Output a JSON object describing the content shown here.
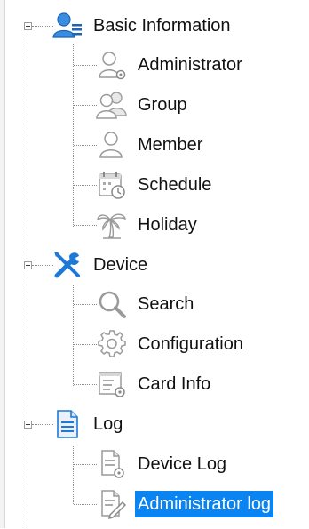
{
  "tree": {
    "groups": [
      {
        "label": "Basic Information",
        "icon": "users-list-icon",
        "children": [
          {
            "label": "Administrator",
            "icon": "admin-user-icon"
          },
          {
            "label": "Group",
            "icon": "group-icon"
          },
          {
            "label": "Member",
            "icon": "member-icon"
          },
          {
            "label": "Schedule",
            "icon": "schedule-icon"
          },
          {
            "label": "Holiday",
            "icon": "palm-tree-icon"
          }
        ]
      },
      {
        "label": "Device",
        "icon": "tools-icon",
        "children": [
          {
            "label": "Search",
            "icon": "magnifier-icon"
          },
          {
            "label": "Configuration",
            "icon": "gear-icon"
          },
          {
            "label": "Card Info",
            "icon": "card-info-icon"
          }
        ]
      },
      {
        "label": "Log",
        "icon": "document-icon",
        "children": [
          {
            "label": "Device Log",
            "icon": "device-log-icon"
          },
          {
            "label": "Administrator log",
            "icon": "admin-log-icon",
            "selected": true
          }
        ]
      }
    ]
  },
  "colors": {
    "selection": "#0a84f0",
    "icon_blue": "#1e78d6",
    "icon_gray": "#b0b0b0"
  }
}
